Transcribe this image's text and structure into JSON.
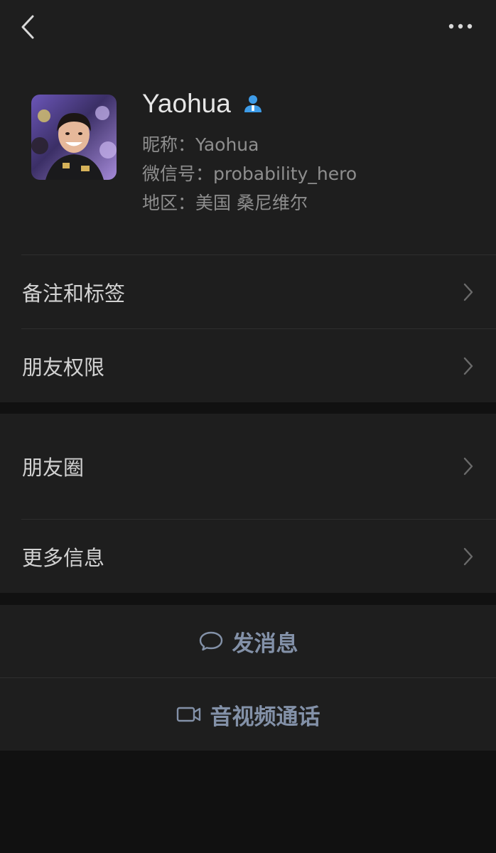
{
  "profile": {
    "name": "Yaohua",
    "nickname_label": "昵称：",
    "nickname": "Yaohua",
    "wechat_id_label": "微信号：",
    "wechat_id": "probability_hero",
    "region_label": "地区：",
    "region": "美国 桑尼维尔",
    "badge_icon": "contact-person-icon"
  },
  "menu": {
    "remarks_tags": "备注和标签",
    "friend_permissions": "朋友权限",
    "moments": "朋友圈",
    "more_info": "更多信息"
  },
  "actions": {
    "send_message": "发消息",
    "video_call": "音视频通话"
  },
  "colors": {
    "background": "#111111",
    "panel": "#1e1e1e",
    "action_text": "#8391a8",
    "badge": "#3e9ce8"
  }
}
